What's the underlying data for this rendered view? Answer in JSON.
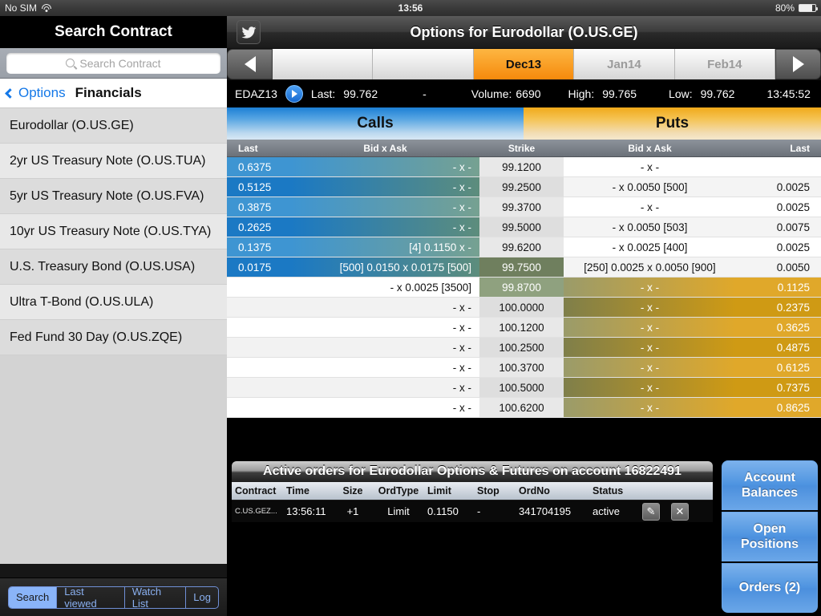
{
  "statusbar": {
    "carrier": "No SIM",
    "wifi_icon": "wifi-icon",
    "time": "13:56",
    "battery_pct": "80%",
    "battery_icon": "battery-icon"
  },
  "sidebar": {
    "title": "Search Contract",
    "search": {
      "placeholder": "Search Contract",
      "value": "",
      "icon": "search-icon"
    },
    "breadcrumb": {
      "back_label": "Options",
      "back_icon": "chevron-left-icon",
      "current": "Financials"
    },
    "items": [
      {
        "label": "Eurodollar (O.US.GE)"
      },
      {
        "label": "2yr US Treasury Note (O.US.TUA)"
      },
      {
        "label": "5yr US Treasury Note (O.US.FVA)"
      },
      {
        "label": "10yr US Treasury Note (O.US.TYA)"
      },
      {
        "label": "U.S. Treasury Bond (O.US.USA)"
      },
      {
        "label": "Ultra T-Bond (O.US.ULA)"
      },
      {
        "label": "Fed Fund 30 Day (O.US.ZQE)"
      }
    ],
    "toolbar": {
      "segments": [
        {
          "label": "Search",
          "selected": true
        },
        {
          "label": "Last viewed",
          "selected": false
        },
        {
          "label": "Watch List",
          "selected": false
        },
        {
          "label": "Log",
          "selected": false
        }
      ]
    }
  },
  "main": {
    "title": "Options for Eurodollar (O.US.GE)",
    "twitter_icon": "twitter-bird-icon",
    "month_tabs": {
      "prev_icon": "arrow-left-icon",
      "next_icon": "arrow-right-icon",
      "tabs": [
        {
          "label": "",
          "state": "empty"
        },
        {
          "label": "",
          "state": "empty"
        },
        {
          "label": "Dec13",
          "state": "selected"
        },
        {
          "label": "Jan14",
          "state": "normal"
        },
        {
          "label": "Feb14",
          "state": "normal"
        }
      ]
    },
    "quote": {
      "symbol": "EDAZ13",
      "info_icon": "info-arrow-icon",
      "last_label": "Last:",
      "last_value": "99.762",
      "change_value": "-",
      "volume_label": "Volume:",
      "volume_value": "6690",
      "high_label": "High:",
      "high_value": "99.765",
      "low_label": "Low:",
      "low_value": "99.762",
      "timestamp": "13:45:52"
    },
    "banner": {
      "calls": "Calls",
      "puts": "Puts"
    },
    "columns": {
      "call_last": "Last",
      "call_bidask": "Bid x Ask",
      "strike": "Strike",
      "put_bidask": "Bid x Ask",
      "put_last": "Last"
    },
    "rows": [
      {
        "call_last": "0.6375",
        "call_bidask": "- x -",
        "strike": "99.1200",
        "put_bidask": "- x -",
        "put_last": ""
      },
      {
        "call_last": "0.5125",
        "call_bidask": "- x -",
        "strike": "99.2500",
        "put_bidask": "- x 0.0050 [500]",
        "put_last": "0.0025"
      },
      {
        "call_last": "0.3875",
        "call_bidask": "- x -",
        "strike": "99.3700",
        "put_bidask": "- x -",
        "put_last": "0.0025"
      },
      {
        "call_last": "0.2625",
        "call_bidask": "- x -",
        "strike": "99.5000",
        "put_bidask": "- x 0.0050 [503]",
        "put_last": "0.0075"
      },
      {
        "call_last": "0.1375",
        "call_bidask": "[4] 0.1150 x -",
        "strike": "99.6200",
        "put_bidask": "- x 0.0025 [400]",
        "put_last": "0.0025"
      },
      {
        "call_last": "0.0175",
        "call_bidask": "[500] 0.0150 x 0.0175 [500]",
        "strike": "99.7500",
        "put_bidask": "[250] 0.0025 x 0.0050 [900]",
        "put_last": "0.0050"
      },
      {
        "call_last": "",
        "call_bidask": "- x 0.0025 [3500]",
        "strike": "99.8700",
        "put_bidask": "- x -",
        "put_last": "0.1125"
      },
      {
        "call_last": "",
        "call_bidask": "- x -",
        "strike": "100.0000",
        "put_bidask": "- x -",
        "put_last": "0.2375"
      },
      {
        "call_last": "",
        "call_bidask": "- x -",
        "strike": "100.1200",
        "put_bidask": "- x -",
        "put_last": "0.3625"
      },
      {
        "call_last": "",
        "call_bidask": "- x -",
        "strike": "100.2500",
        "put_bidask": "- x -",
        "put_last": "0.4875"
      },
      {
        "call_last": "",
        "call_bidask": "- x -",
        "strike": "100.3700",
        "put_bidask": "- x -",
        "put_last": "0.6125"
      },
      {
        "call_last": "",
        "call_bidask": "- x -",
        "strike": "100.5000",
        "put_bidask": "- x -",
        "put_last": "0.7375"
      },
      {
        "call_last": "",
        "call_bidask": "- x -",
        "strike": "100.6200",
        "put_bidask": "- x -",
        "put_last": "0.8625"
      }
    ]
  },
  "orders": {
    "title": "Active orders for Eurodollar Options & Futures on account 16822491",
    "columns": [
      "Contract",
      "Time",
      "Size",
      "OrdType",
      "Limit",
      "Stop",
      "OrdNo",
      "Status"
    ],
    "rows": [
      {
        "contract": "C.US.GEZ...",
        "time": "13:56:11",
        "size": "+1",
        "ordtype": "Limit",
        "limit": "0.1150",
        "stop": "-",
        "ordno": "341704195",
        "status": "active",
        "edit_icon": "edit-icon",
        "cancel_icon": "close-icon"
      }
    ]
  },
  "account_buttons": [
    {
      "line1": "Account",
      "line2": "Balances"
    },
    {
      "line1": "Open",
      "line2": "Positions"
    },
    {
      "line1": "Orders (2)",
      "line2": ""
    }
  ],
  "colors": {
    "accent_blue": "#1b79c4",
    "accent_orange": "#f68a0c",
    "selected_tab": "#fdb642",
    "link_blue": "#1478e8"
  }
}
